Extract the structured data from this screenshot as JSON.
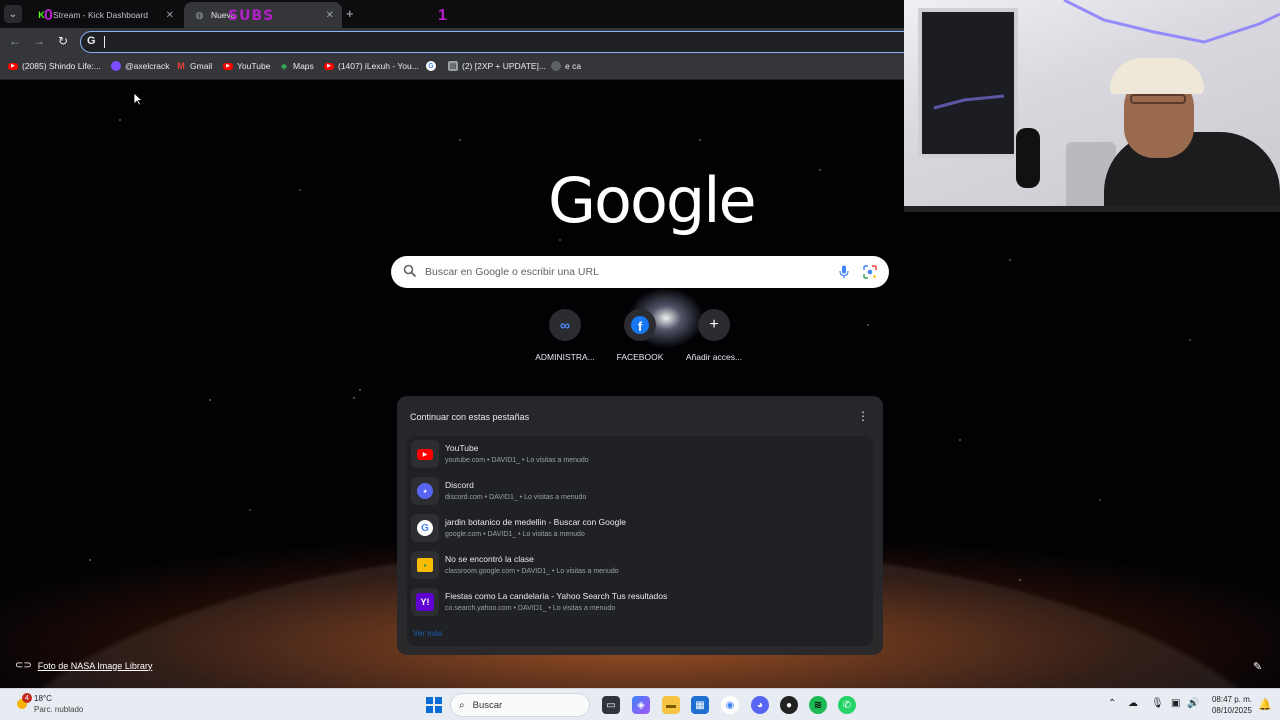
{
  "browser": {
    "tabs": [
      {
        "title": "Stream - Kick Dashboard",
        "icon": "kick-icon",
        "active": false
      },
      {
        "title": "Nueva",
        "icon": "globe-icon",
        "active": true
      }
    ],
    "overlay_text": "SUBS",
    "overlay_counter": "1",
    "overlay_counter_left": "0",
    "new_tab_symbol": "+",
    "omnibox_value": ""
  },
  "bookmarks": [
    {
      "label": "(2085) Shindo Life:...",
      "icon": "youtube-icon"
    },
    {
      "label": "@axelcrack",
      "icon": "avatar-icon"
    },
    {
      "label": "Gmail",
      "icon": "gmail-icon"
    },
    {
      "label": "YouTube",
      "icon": "youtube-icon"
    },
    {
      "label": "Maps",
      "icon": "maps-icon"
    },
    {
      "label": "(1407) iLexuh - You...",
      "icon": "youtube-icon"
    },
    {
      "label": "",
      "icon": "google-icon"
    },
    {
      "label": "(2) [2XP + UPDATE]...",
      "icon": "document-icon"
    },
    {
      "label": "e ca",
      "icon": "dot-icon"
    }
  ],
  "newtab": {
    "logo": "Google",
    "search_placeholder": "Buscar en Google o escribir una URL",
    "shortcuts": [
      {
        "label": "ADMINISTRA...",
        "icon": "meta-icon"
      },
      {
        "label": "FACEBOOK",
        "icon": "facebook-icon"
      },
      {
        "label": "Añadir acces...",
        "icon": "plus-icon"
      }
    ],
    "continue_card": {
      "title": "Continuar con estas pestañas",
      "rows": [
        {
          "title": "YouTube",
          "sub": "youtube.com • DAVID1_ • Lo visitas a menudo",
          "icon": "youtube-icon"
        },
        {
          "title": "Discord",
          "sub": "discord.com • DAVID1_ • Lo visitas a menudo",
          "icon": "discord-icon"
        },
        {
          "title": "jardin botanico de medellin - Buscar con Google",
          "sub": "google.com • DAVID1_ • Lo visitas a menudo",
          "icon": "google-icon"
        },
        {
          "title": "No se encontró la clase",
          "sub": "classroom.google.com • DAVID1_ • Lo visitas a menudo",
          "icon": "classroom-icon"
        },
        {
          "title": "Fiestas como La candelaria - Yahoo Search Tus resultados",
          "sub": "co.search.yahoo.com • DAVID1_ • Lo visitas a menudo",
          "icon": "yahoo-icon"
        }
      ],
      "more_link": "Ver más"
    },
    "background_credit": "Foto de NASA Image Library"
  },
  "taskbar": {
    "weather": {
      "temp": "18°C",
      "condition": "Parc. nublado",
      "badge": "4"
    },
    "search_label": "Buscar",
    "clock_time": "08:47 p. m.",
    "clock_date": "08/10/2025"
  },
  "colors": {
    "accent": "#8ab4f8",
    "overlay_purple": "#b41fc9",
    "kick_green": "#53fc18"
  }
}
